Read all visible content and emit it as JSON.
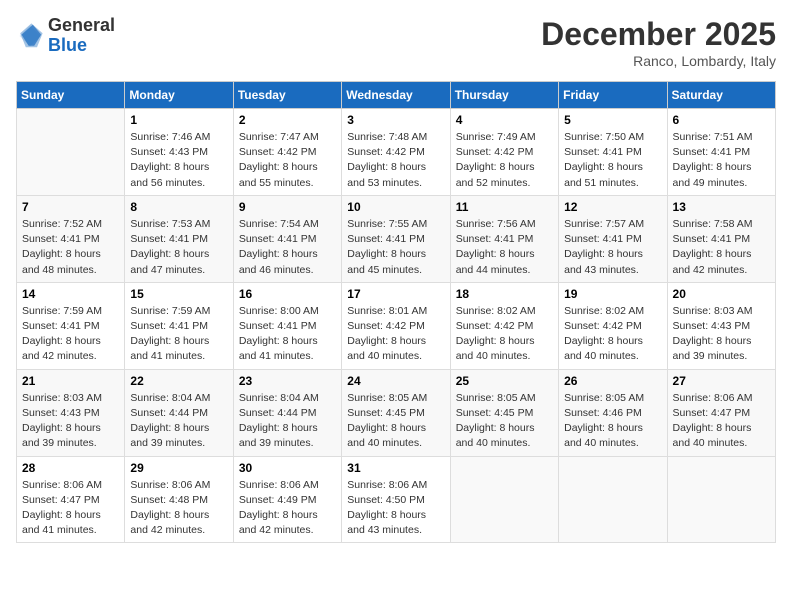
{
  "logo": {
    "general": "General",
    "blue": "Blue"
  },
  "header": {
    "month": "December 2025",
    "location": "Ranco, Lombardy, Italy"
  },
  "days_of_week": [
    "Sunday",
    "Monday",
    "Tuesday",
    "Wednesday",
    "Thursday",
    "Friday",
    "Saturday"
  ],
  "weeks": [
    [
      {
        "day": "",
        "sunrise": "",
        "sunset": "",
        "daylight": ""
      },
      {
        "day": "1",
        "sunrise": "Sunrise: 7:46 AM",
        "sunset": "Sunset: 4:43 PM",
        "daylight": "Daylight: 8 hours and 56 minutes."
      },
      {
        "day": "2",
        "sunrise": "Sunrise: 7:47 AM",
        "sunset": "Sunset: 4:42 PM",
        "daylight": "Daylight: 8 hours and 55 minutes."
      },
      {
        "day": "3",
        "sunrise": "Sunrise: 7:48 AM",
        "sunset": "Sunset: 4:42 PM",
        "daylight": "Daylight: 8 hours and 53 minutes."
      },
      {
        "day": "4",
        "sunrise": "Sunrise: 7:49 AM",
        "sunset": "Sunset: 4:42 PM",
        "daylight": "Daylight: 8 hours and 52 minutes."
      },
      {
        "day": "5",
        "sunrise": "Sunrise: 7:50 AM",
        "sunset": "Sunset: 4:41 PM",
        "daylight": "Daylight: 8 hours and 51 minutes."
      },
      {
        "day": "6",
        "sunrise": "Sunrise: 7:51 AM",
        "sunset": "Sunset: 4:41 PM",
        "daylight": "Daylight: 8 hours and 49 minutes."
      }
    ],
    [
      {
        "day": "7",
        "sunrise": "Sunrise: 7:52 AM",
        "sunset": "Sunset: 4:41 PM",
        "daylight": "Daylight: 8 hours and 48 minutes."
      },
      {
        "day": "8",
        "sunrise": "Sunrise: 7:53 AM",
        "sunset": "Sunset: 4:41 PM",
        "daylight": "Daylight: 8 hours and 47 minutes."
      },
      {
        "day": "9",
        "sunrise": "Sunrise: 7:54 AM",
        "sunset": "Sunset: 4:41 PM",
        "daylight": "Daylight: 8 hours and 46 minutes."
      },
      {
        "day": "10",
        "sunrise": "Sunrise: 7:55 AM",
        "sunset": "Sunset: 4:41 PM",
        "daylight": "Daylight: 8 hours and 45 minutes."
      },
      {
        "day": "11",
        "sunrise": "Sunrise: 7:56 AM",
        "sunset": "Sunset: 4:41 PM",
        "daylight": "Daylight: 8 hours and 44 minutes."
      },
      {
        "day": "12",
        "sunrise": "Sunrise: 7:57 AM",
        "sunset": "Sunset: 4:41 PM",
        "daylight": "Daylight: 8 hours and 43 minutes."
      },
      {
        "day": "13",
        "sunrise": "Sunrise: 7:58 AM",
        "sunset": "Sunset: 4:41 PM",
        "daylight": "Daylight: 8 hours and 42 minutes."
      }
    ],
    [
      {
        "day": "14",
        "sunrise": "Sunrise: 7:59 AM",
        "sunset": "Sunset: 4:41 PM",
        "daylight": "Daylight: 8 hours and 42 minutes."
      },
      {
        "day": "15",
        "sunrise": "Sunrise: 7:59 AM",
        "sunset": "Sunset: 4:41 PM",
        "daylight": "Daylight: 8 hours and 41 minutes."
      },
      {
        "day": "16",
        "sunrise": "Sunrise: 8:00 AM",
        "sunset": "Sunset: 4:41 PM",
        "daylight": "Daylight: 8 hours and 41 minutes."
      },
      {
        "day": "17",
        "sunrise": "Sunrise: 8:01 AM",
        "sunset": "Sunset: 4:42 PM",
        "daylight": "Daylight: 8 hours and 40 minutes."
      },
      {
        "day": "18",
        "sunrise": "Sunrise: 8:02 AM",
        "sunset": "Sunset: 4:42 PM",
        "daylight": "Daylight: 8 hours and 40 minutes."
      },
      {
        "day": "19",
        "sunrise": "Sunrise: 8:02 AM",
        "sunset": "Sunset: 4:42 PM",
        "daylight": "Daylight: 8 hours and 40 minutes."
      },
      {
        "day": "20",
        "sunrise": "Sunrise: 8:03 AM",
        "sunset": "Sunset: 4:43 PM",
        "daylight": "Daylight: 8 hours and 39 minutes."
      }
    ],
    [
      {
        "day": "21",
        "sunrise": "Sunrise: 8:03 AM",
        "sunset": "Sunset: 4:43 PM",
        "daylight": "Daylight: 8 hours and 39 minutes."
      },
      {
        "day": "22",
        "sunrise": "Sunrise: 8:04 AM",
        "sunset": "Sunset: 4:44 PM",
        "daylight": "Daylight: 8 hours and 39 minutes."
      },
      {
        "day": "23",
        "sunrise": "Sunrise: 8:04 AM",
        "sunset": "Sunset: 4:44 PM",
        "daylight": "Daylight: 8 hours and 39 minutes."
      },
      {
        "day": "24",
        "sunrise": "Sunrise: 8:05 AM",
        "sunset": "Sunset: 4:45 PM",
        "daylight": "Daylight: 8 hours and 40 minutes."
      },
      {
        "day": "25",
        "sunrise": "Sunrise: 8:05 AM",
        "sunset": "Sunset: 4:45 PM",
        "daylight": "Daylight: 8 hours and 40 minutes."
      },
      {
        "day": "26",
        "sunrise": "Sunrise: 8:05 AM",
        "sunset": "Sunset: 4:46 PM",
        "daylight": "Daylight: 8 hours and 40 minutes."
      },
      {
        "day": "27",
        "sunrise": "Sunrise: 8:06 AM",
        "sunset": "Sunset: 4:47 PM",
        "daylight": "Daylight: 8 hours and 40 minutes."
      }
    ],
    [
      {
        "day": "28",
        "sunrise": "Sunrise: 8:06 AM",
        "sunset": "Sunset: 4:47 PM",
        "daylight": "Daylight: 8 hours and 41 minutes."
      },
      {
        "day": "29",
        "sunrise": "Sunrise: 8:06 AM",
        "sunset": "Sunset: 4:48 PM",
        "daylight": "Daylight: 8 hours and 42 minutes."
      },
      {
        "day": "30",
        "sunrise": "Sunrise: 8:06 AM",
        "sunset": "Sunset: 4:49 PM",
        "daylight": "Daylight: 8 hours and 42 minutes."
      },
      {
        "day": "31",
        "sunrise": "Sunrise: 8:06 AM",
        "sunset": "Sunset: 4:50 PM",
        "daylight": "Daylight: 8 hours and 43 minutes."
      },
      {
        "day": "",
        "sunrise": "",
        "sunset": "",
        "daylight": ""
      },
      {
        "day": "",
        "sunrise": "",
        "sunset": "",
        "daylight": ""
      },
      {
        "day": "",
        "sunrise": "",
        "sunset": "",
        "daylight": ""
      }
    ]
  ]
}
